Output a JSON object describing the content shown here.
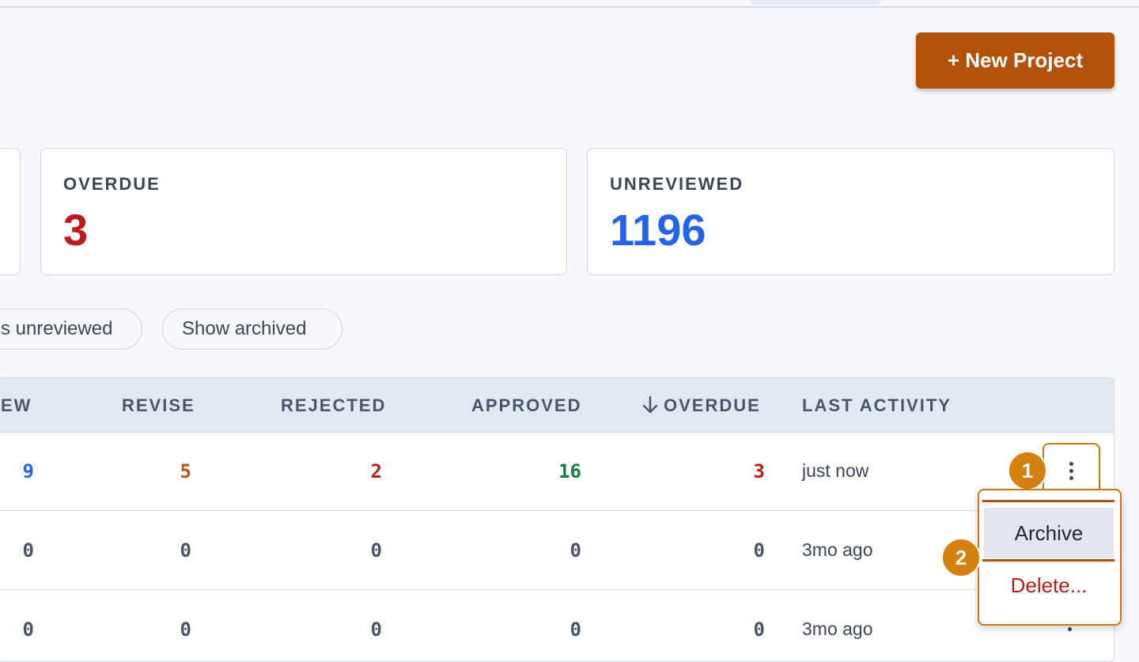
{
  "header": {
    "new_project_label": "+ New Project"
  },
  "stats": {
    "overdue": {
      "label": "OVERDUE",
      "value": "3",
      "color": "#b91c1c"
    },
    "unreviewed": {
      "label": "UNREVIEWED",
      "value": "1196",
      "color": "#2563eb"
    }
  },
  "filters": {
    "unreviewed_pill": "s unreviewed",
    "archived_pill": "Show archived"
  },
  "table": {
    "columns": {
      "review": "EW",
      "revise": "REVISE",
      "rejected": "REJECTED",
      "approved": "APPROVED",
      "overdue": "OVERDUE",
      "last_activity": "LAST ACTIVITY"
    },
    "sort_icon": "arrow-down-icon",
    "rows": [
      {
        "review": "9",
        "revise": "5",
        "rejected": "2",
        "approved": "16",
        "overdue": "3",
        "last_activity": "just now"
      },
      {
        "review": "0",
        "revise": "0",
        "rejected": "0",
        "approved": "0",
        "overdue": "0",
        "last_activity": "3mo ago"
      },
      {
        "review": "0",
        "revise": "0",
        "rejected": "0",
        "approved": "0",
        "overdue": "0",
        "last_activity": "3mo ago"
      }
    ],
    "colors": {
      "review": "#2563eb",
      "revise": "#b45309",
      "rejected": "#b91c1c",
      "approved": "#15803d",
      "overdue": "#b91c1c"
    }
  },
  "row_menu": {
    "archive_label": "Archive",
    "delete_label": "Delete...",
    "icon": "kebab-menu-icon"
  },
  "annotations": {
    "step1": "1",
    "step2": "2"
  }
}
